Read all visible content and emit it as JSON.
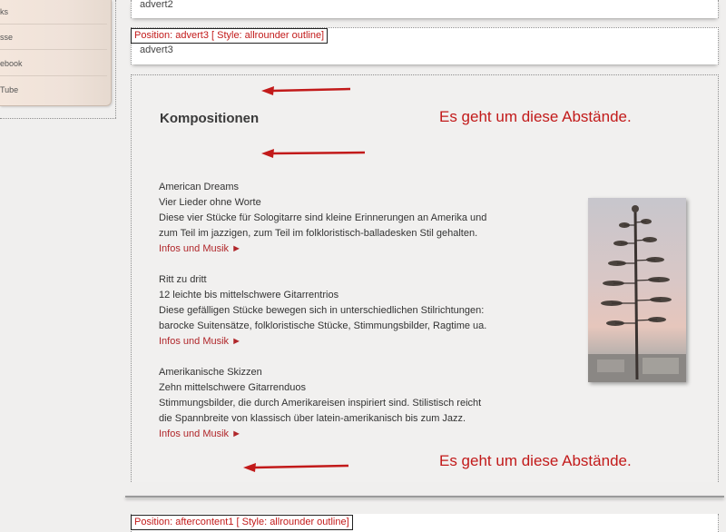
{
  "sidebar": {
    "items": [
      {
        "label": "ks"
      },
      {
        "label": "sse"
      },
      {
        "label": "ebook"
      },
      {
        "label": "Tube"
      }
    ]
  },
  "modules": {
    "advert2": {
      "text": "advert2"
    },
    "advert3": {
      "label": "Position: advert3 [ Style: allrounder outline]",
      "text": "advert3"
    },
    "aftercontent1": {
      "label": "Position: aftercontent1 [ Style: allrounder outline]"
    }
  },
  "content": {
    "heading": "Kompositionen",
    "note_top": "Es geht um diese Abstände.",
    "note_bottom": "Es geht um diese Abstände.",
    "items": [
      {
        "title": "American Dreams",
        "subtitle": "Vier Lieder ohne Worte",
        "desc1": "Diese vier Stücke für Sologitarre sind kleine Erinnerungen an Amerika und",
        "desc2": "zum Teil im jazzigen, zum Teil im folkloristisch-balladesken Stil gehalten.",
        "link": "Infos und Musik ►"
      },
      {
        "title": "Ritt zu dritt",
        "subtitle": "12 leichte bis mittelschwere Gitarrentrios",
        "desc1": "Diese gefälligen Stücke bewegen sich in unterschiedlichen Stilrichtungen:",
        "desc2": "barocke Suitensätze, folkloristische Stücke, Stimmungsbilder, Ragtime ua.",
        "link": "Infos und Musik ►"
      },
      {
        "title": "Amerikanische Skizzen",
        "subtitle": "Zehn mittelschwere Gitarrenduos",
        "desc1": "Stimmungsbilder, die durch Amerikareisen inspiriert sind. Stilistisch reicht",
        "desc2": "die Spannbreite von klassisch über latein-amerikanisch bis zum Jazz.",
        "link": "Infos und Musik ►"
      }
    ]
  },
  "colors": {
    "accent_red": "#c21a1a",
    "link_red": "#b0262a",
    "background": "#f0efee"
  }
}
